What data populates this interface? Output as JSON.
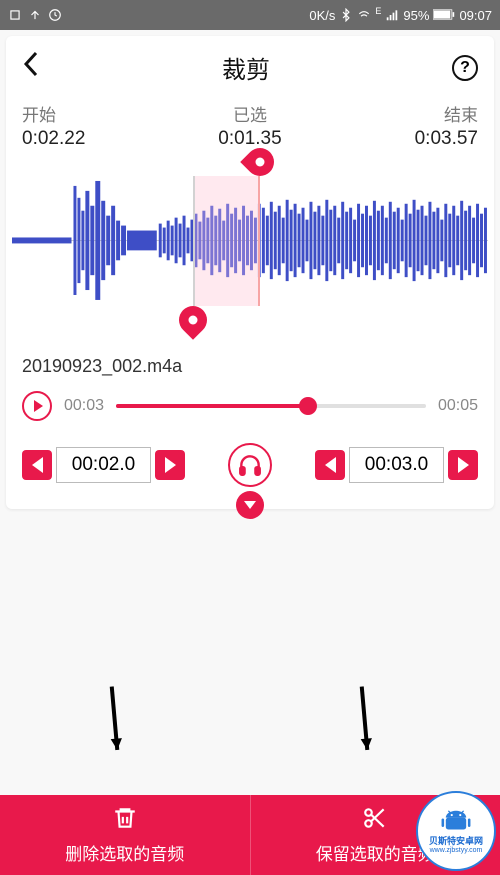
{
  "status_bar": {
    "net_speed": "0K/s",
    "signal_type": "E",
    "battery_pct": "95%",
    "time": "09:07"
  },
  "header": {
    "title": "裁剪"
  },
  "times": {
    "start_label": "开始",
    "start_value": "0:02.22",
    "selected_label": "已选",
    "selected_value": "0:01.35",
    "end_label": "结束",
    "end_value": "0:03.57"
  },
  "file": {
    "name": "20190923_002.m4a"
  },
  "playback": {
    "current": "00:03",
    "duration": "00:05",
    "progress_pct": 62
  },
  "steppers": {
    "start_value": "00:02.0",
    "end_value": "00:03.0"
  },
  "bottom": {
    "delete_label": "删除选取的音频",
    "keep_label": "保留选取的音频"
  },
  "watermark": {
    "line1": "贝斯特安卓网",
    "line2": "www.zjbstyy.com"
  },
  "colors": {
    "accent": "#e8194b",
    "wave": "#3e4ec6"
  }
}
